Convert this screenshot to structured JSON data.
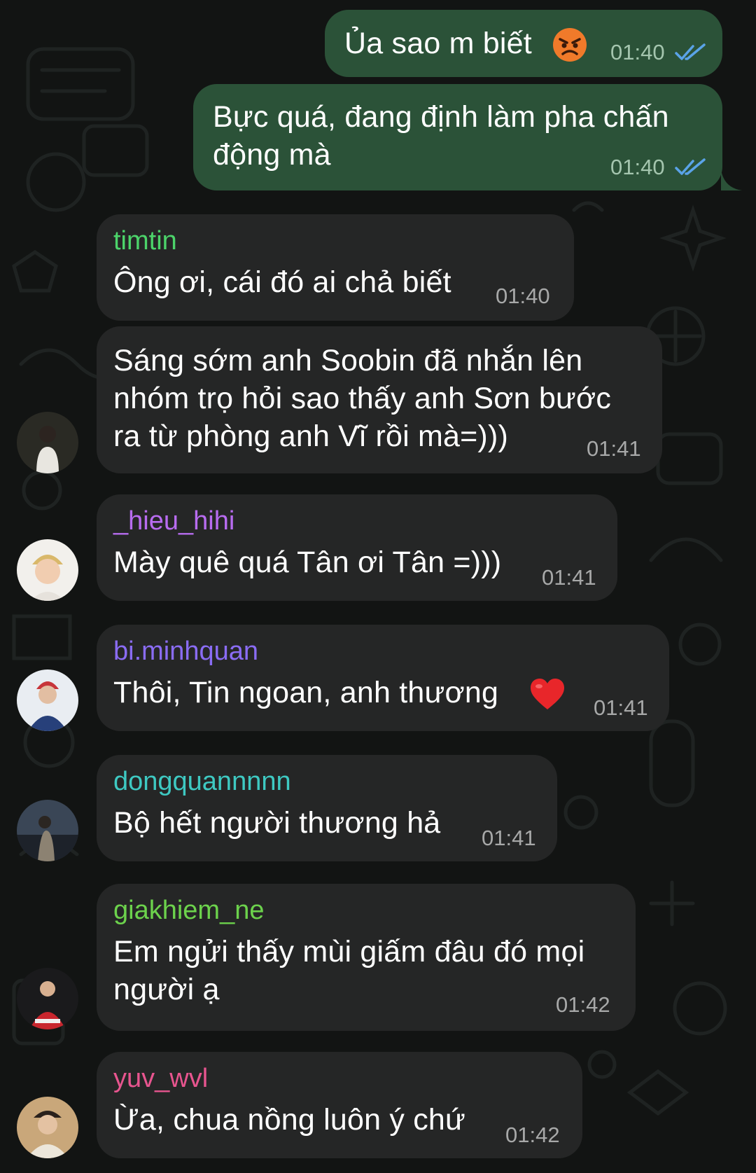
{
  "colors": {
    "outgoing_bubble": "#2b5238",
    "incoming_bubble": "#252626",
    "background": "#121413",
    "read_checks": "#5aa3e8"
  },
  "messages": {
    "m1": {
      "direction": "out",
      "text": "Ủa sao m biết",
      "emoji": "angry-face-emoji",
      "time": "01:40",
      "status": "read"
    },
    "m2": {
      "direction": "out",
      "text": "Bực quá, đang định làm pha chấn\nđộng mà",
      "time": "01:40",
      "status": "read"
    },
    "m3": {
      "direction": "in",
      "sender": "timtin",
      "sender_color": "#4cd46a",
      "text": "Ông ơi, cái đó ai chả biết",
      "time": "01:40"
    },
    "m4": {
      "direction": "in",
      "text": "Sáng sớm anh Soobin đã nhắn lên\nnhóm trọ hỏi sao thấy anh Sơn bước\nra từ phòng anh Vĩ rồi mà=)))",
      "time": "01:41",
      "avatar": "avatar-timtin"
    },
    "m5": {
      "direction": "in",
      "sender": "_hieu_hihi",
      "sender_color": "#b86cf0",
      "text": "Mày quê quá Tân ơi Tân =)))",
      "time": "01:41",
      "avatar": "avatar-hieu-hihi"
    },
    "m6": {
      "direction": "in",
      "sender": "bi.minhquan",
      "sender_color": "#8a6cf4",
      "text": "Thôi, Tin ngoan, anh thương",
      "emoji": "red-heart-emoji",
      "time": "01:41",
      "avatar": "avatar-bi-minhquan"
    },
    "m7": {
      "direction": "in",
      "sender": "dongquannnnn",
      "sender_color": "#3ec9c2",
      "text": "Bộ hết người thương hả",
      "time": "01:41",
      "avatar": "avatar-dongquannnnn"
    },
    "m8": {
      "direction": "in",
      "sender": "giakhiem_ne",
      "sender_color": "#6cd24c",
      "text": "Em ngửi thấy mùi giấm đâu đó mọi\nngười ạ",
      "time": "01:42",
      "avatar": "avatar-giakhiem-ne"
    },
    "m9": {
      "direction": "in",
      "sender": "yuv_wvl",
      "sender_color": "#e8558f",
      "text": "Ừa, chua nồng luôn ý chứ",
      "time": "01:42",
      "avatar": "avatar-yuv-wvl"
    }
  }
}
